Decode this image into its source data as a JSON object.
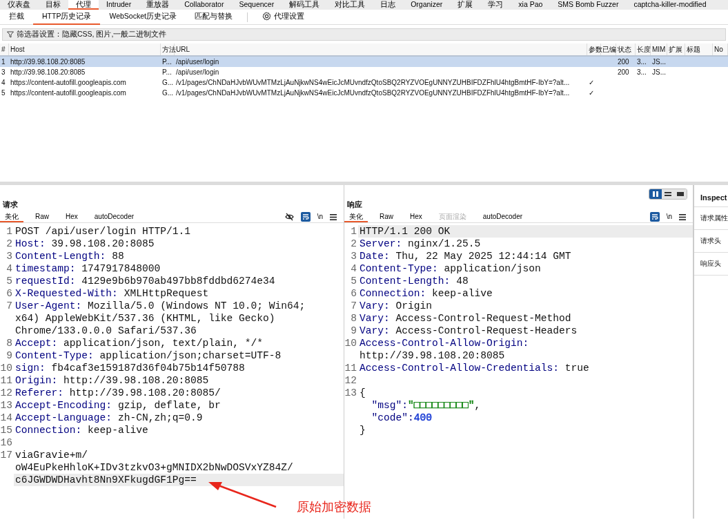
{
  "main_tabs": [
    {
      "label": "仪表盘",
      "selected": false
    },
    {
      "label": "目标",
      "selected": false
    },
    {
      "label": "代理",
      "selected": true
    },
    {
      "label": "Intruder",
      "selected": false
    },
    {
      "label": "重放器",
      "selected": false
    },
    {
      "label": "Collaborator",
      "selected": false
    },
    {
      "label": "Sequencer",
      "selected": false
    },
    {
      "label": "解码工具",
      "selected": false
    },
    {
      "label": "对比工具",
      "selected": false
    },
    {
      "label": "日志",
      "selected": false
    },
    {
      "label": "Organizer",
      "selected": false
    },
    {
      "label": "扩展",
      "selected": false
    },
    {
      "label": "学习",
      "selected": false
    },
    {
      "label": "xia Pao",
      "selected": false
    },
    {
      "label": "SMS Bomb Fuzzer",
      "selected": false
    },
    {
      "label": "captcha-killer-modified",
      "selected": false
    }
  ],
  "sub_tabs": [
    {
      "label": "拦截",
      "selected": false
    },
    {
      "label": "HTTP历史记录",
      "selected": true
    },
    {
      "label": "WebSocket历史记录",
      "selected": false
    },
    {
      "label": "匹配与替换",
      "selected": false
    }
  ],
  "proxy_settings": "代理设置",
  "filter": "筛选器设置：隐藏CSS, 图片,一般二进制文件",
  "table": {
    "columns": [
      "#",
      "Host",
      "方法",
      "URL",
      "参数",
      "已编",
      "状态",
      "长度",
      "MIM",
      "扩展",
      "标题",
      "No"
    ],
    "rows": [
      {
        "selected": true,
        "number": "1",
        "host": "http://39.98.108.20:8085",
        "method": "P...",
        "url": "/api/user/login",
        "status": "200",
        "length": "3...",
        "mime": "JS..."
      },
      {
        "selected": false,
        "number": "3",
        "host": "http://39.98.108.20:8085",
        "method": "P...",
        "url": "/api/user/login",
        "status": "200",
        "length": "3...",
        "mime": "JS..."
      },
      {
        "selected": false,
        "number": "4",
        "host": "https://content-autofill.googleapis.com",
        "method": "G...",
        "url": "/v1/pages/ChNDaHJvbWUvMTMzLjAuNjkwNS4wEicJcMUvndfzQtoSBQ2RYZVOEgUNNYZUHBIFDZFhlU4htgBmtHF-IbY=?alt...",
        "params": "✓"
      },
      {
        "selected": false,
        "number": "5",
        "host": "https://content-autofill.googleapis.com",
        "method": "G...",
        "url": "/v1/pages/ChNDaHJvbWUvMTMzLjAuNjkwNS4wEicJcMUvndfzQtoSBQ2RYZVOEgUNNYZUHBIFDZFhlU4htgBmtHF-IbY=?alt...",
        "params": "✓"
      }
    ]
  },
  "layout_buttons": [
    {
      "selected": true
    },
    {
      "selected": false
    },
    {
      "selected": false
    }
  ],
  "request": {
    "title": "请求",
    "tabs": [
      {
        "label": "美化",
        "selected": true,
        "disabled": false
      },
      {
        "label": "Raw",
        "selected": false,
        "disabled": false
      },
      {
        "label": "Hex",
        "selected": false,
        "disabled": false
      },
      {
        "label": "autoDecoder",
        "selected": false,
        "disabled": false
      }
    ],
    "newline_toggle": "\\n",
    "lines": [
      {
        "number": "1",
        "kind": "plain",
        "rows": [
          "POST /api/user/login HTTP/1.1"
        ]
      },
      {
        "number": "2",
        "kind": "header",
        "name": "Host:",
        "rows": [
          "39.98.108.20:8085"
        ]
      },
      {
        "number": "3",
        "kind": "header",
        "name": "Content-Length:",
        "rows": [
          "88"
        ]
      },
      {
        "number": "4",
        "kind": "header",
        "name": "timestamp:",
        "rows": [
          "1747917848000"
        ]
      },
      {
        "number": "5",
        "kind": "header",
        "name": "requestId:",
        "rows": [
          "4129e9b6b970ab497bb8fddbd6274e34"
        ]
      },
      {
        "number": "6",
        "kind": "header",
        "name": "X-Requested-With:",
        "rows": [
          "XMLHttpRequest"
        ]
      },
      {
        "number": "7",
        "kind": "header",
        "name": "User-Agent:",
        "rows": [
          "Mozilla/5.0 (Windows NT 10.0; Win64;",
          "x64) AppleWebKit/537.36 (KHTML, like Gecko)",
          "Chrome/133.0.0.0 Safari/537.36"
        ]
      },
      {
        "number": "8",
        "kind": "header",
        "name": "Accept:",
        "rows": [
          "application/json, text/plain, */*"
        ]
      },
      {
        "number": "9",
        "kind": "header",
        "name": "Content-Type:",
        "rows": [
          "application/json;charset=UTF-8"
        ]
      },
      {
        "number": "10",
        "kind": "header",
        "name": "sign:",
        "rows": [
          "fb4caf3e159187d36f04b75b14f50788"
        ]
      },
      {
        "number": "11",
        "kind": "header",
        "name": "Origin:",
        "rows": [
          "http://39.98.108.20:8085"
        ]
      },
      {
        "number": "12",
        "kind": "header",
        "name": "Referer:",
        "rows": [
          "http://39.98.108.20:8085/"
        ]
      },
      {
        "number": "13",
        "kind": "header",
        "name": "Accept-Encoding:",
        "rows": [
          "gzip, deflate, br"
        ]
      },
      {
        "number": "14",
        "kind": "header",
        "name": "Accept-Language:",
        "rows": [
          "zh-CN,zh;q=0.9"
        ]
      },
      {
        "number": "15",
        "kind": "header",
        "name": "Connection:",
        "rows": [
          "keep-alive"
        ]
      },
      {
        "number": "16",
        "kind": "blank"
      },
      {
        "number": "17",
        "kind": "plain",
        "rows": [
          "viaGravie+m/",
          "oW4EuPkeHhloK+IDv3tzkvO3+gMNIDX2bNwDOSVxYZ84Z/",
          "c6JGWDWDHavht8Nn9XFkugdGF1Pg=="
        ],
        "current": true
      }
    ]
  },
  "response": {
    "title": "响应",
    "tabs": [
      {
        "label": "美化",
        "selected": true,
        "disabled": false
      },
      {
        "label": "Raw",
        "selected": false,
        "disabled": false
      },
      {
        "label": "Hex",
        "selected": false,
        "disabled": false
      },
      {
        "label": "页面渲染",
        "selected": false,
        "disabled": true
      },
      {
        "label": "autoDecoder",
        "selected": false,
        "disabled": false
      }
    ],
    "newline_toggle": "\\n",
    "lines": [
      {
        "number": "1",
        "kind": "plain",
        "rows": [
          "HTTP/1.1 200 OK"
        ],
        "current": true
      },
      {
        "number": "2",
        "kind": "header",
        "name": "Server:",
        "rows": [
          "nginx/1.25.5"
        ]
      },
      {
        "number": "3",
        "kind": "header",
        "name": "Date:",
        "rows": [
          "Thu, 22 May 2025 12:44:14 GMT"
        ]
      },
      {
        "number": "4",
        "kind": "header",
        "name": "Content-Type:",
        "rows": [
          "application/json"
        ]
      },
      {
        "number": "5",
        "kind": "header",
        "name": "Content-Length:",
        "rows": [
          "48"
        ]
      },
      {
        "number": "6",
        "kind": "header",
        "name": "Connection:",
        "rows": [
          "keep-alive"
        ]
      },
      {
        "number": "7",
        "kind": "header",
        "name": "Vary:",
        "rows": [
          "Origin"
        ]
      },
      {
        "number": "8",
        "kind": "header",
        "name": "Vary:",
        "rows": [
          "Access-Control-Request-Method"
        ]
      },
      {
        "number": "9",
        "kind": "header",
        "name": "Vary:",
        "rows": [
          "Access-Control-Request-Headers"
        ]
      },
      {
        "number": "10",
        "kind": "header",
        "name": "Access-Control-Allow-Origin:",
        "value_on_next_row": true,
        "rows": [
          "http://39.98.108.20:8085"
        ]
      },
      {
        "number": "11",
        "kind": "header",
        "name": "Access-Control-Allow-Credentials:",
        "rows": [
          "true"
        ]
      },
      {
        "number": "12",
        "kind": "blank"
      },
      {
        "number": "13",
        "kind": "json",
        "open": "{",
        "close": "}",
        "fields": [
          {
            "key": "\"msg\":",
            "value": "\"□□□□□□□□□\"",
            "color": "#1a8a1a",
            "trail": ","
          },
          {
            "key": "\"code\":",
            "value": "400",
            "color": "#1d3fd6"
          }
        ]
      }
    ]
  },
  "inspector": {
    "title": "Inspect",
    "items": [
      "请求属性",
      "请求头",
      "响应头"
    ]
  },
  "annotation": "原始加密数据"
}
